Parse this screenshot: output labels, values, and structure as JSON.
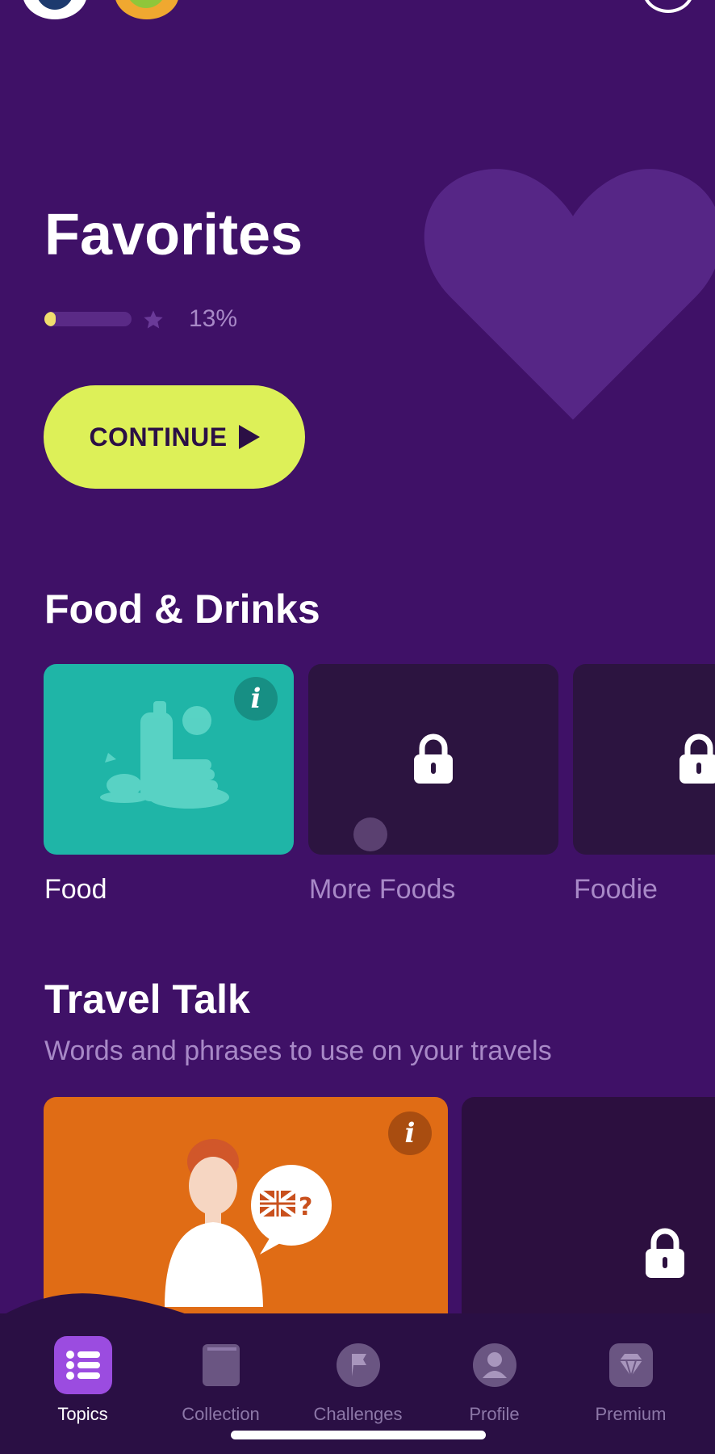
{
  "hero": {
    "title": "Favorites",
    "progress_percent": 13,
    "progress_label": "13%",
    "continue_label": "CONTINUE"
  },
  "sections": [
    {
      "title": "Food & Drinks",
      "cards": [
        {
          "label": "Food",
          "locked": false
        },
        {
          "label": "More Foods",
          "locked": true
        },
        {
          "label": "Foodie",
          "locked": true
        }
      ]
    },
    {
      "title": "Travel Talk",
      "subtitle": "Words and phrases to use on your travels",
      "cards": [
        {
          "label": "",
          "locked": false
        },
        {
          "label": "",
          "locked": true
        }
      ]
    }
  ],
  "nav": {
    "items": [
      {
        "label": "Topics",
        "icon": "list-icon",
        "active": true
      },
      {
        "label": "Collection",
        "icon": "book-icon",
        "active": false
      },
      {
        "label": "Challenges",
        "icon": "flag-icon",
        "active": false
      },
      {
        "label": "Profile",
        "icon": "person-icon",
        "active": false
      },
      {
        "label": "Premium",
        "icon": "diamond-icon",
        "active": false
      }
    ]
  },
  "colors": {
    "background": "#3f1167",
    "accent": "#ddf058",
    "food_card": "#1fb5a7",
    "travel_card": "#e06c15",
    "nav_active": "#9b4ce0"
  }
}
